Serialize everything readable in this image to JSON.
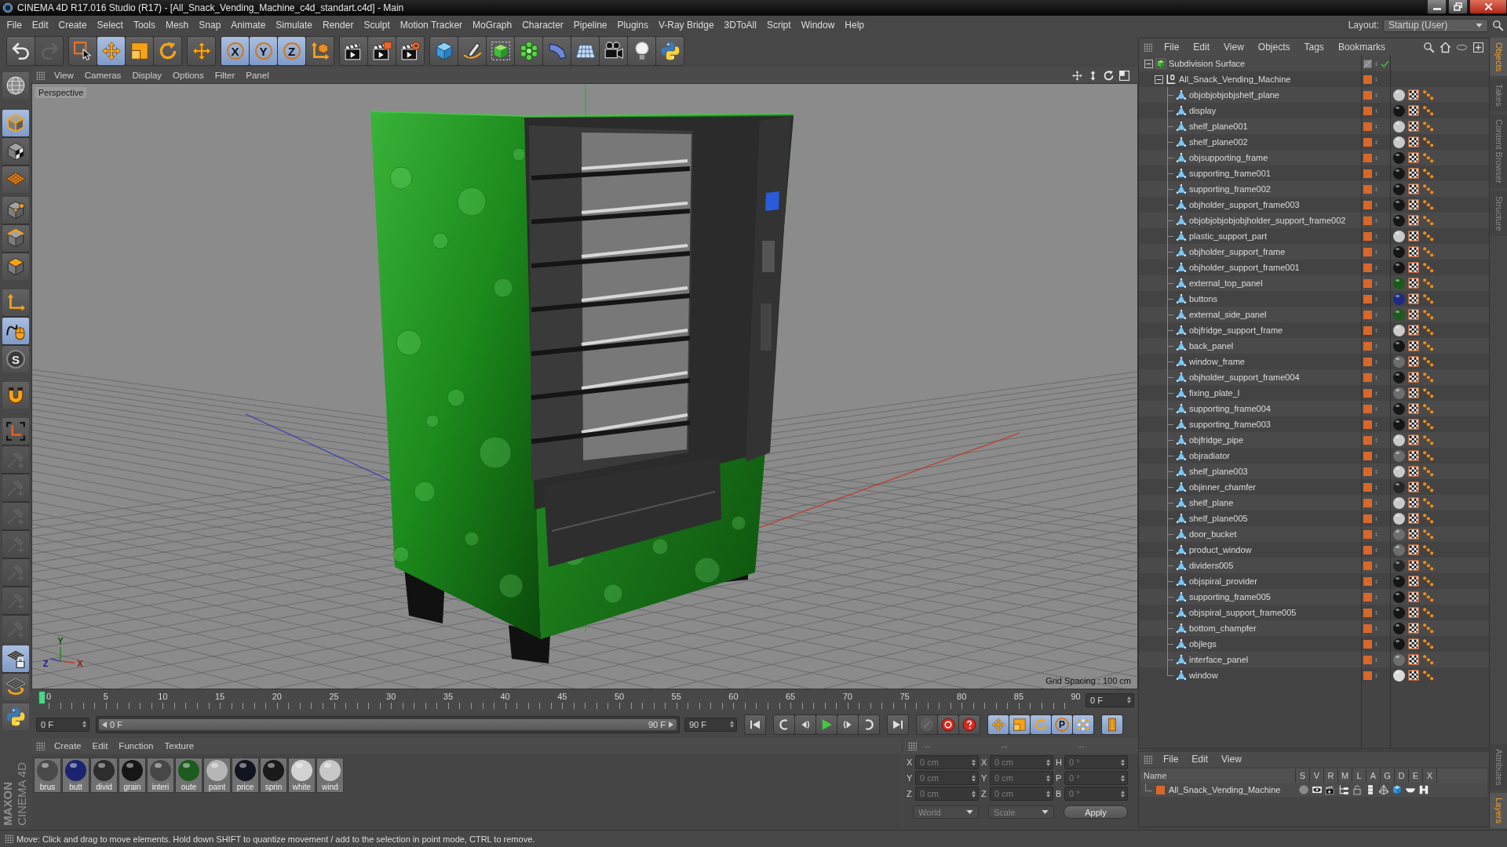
{
  "window": {
    "title": "CINEMA 4D R17.016 Studio (R17) - [All_Snack_Vending_Machine_c4d_standart.c4d] - Main"
  },
  "menu_bar": [
    "File",
    "Edit",
    "Create",
    "Select",
    "Tools",
    "Mesh",
    "Snap",
    "Animate",
    "Simulate",
    "Render",
    "Sculpt",
    "Motion Tracker",
    "MoGraph",
    "Character",
    "Pipeline",
    "Plugins",
    "V-Ray Bridge",
    "3DToAll",
    "Script",
    "Window",
    "Help"
  ],
  "layout": {
    "label": "Layout:",
    "value": "Startup (User)"
  },
  "toolbar": [
    {
      "tools": [
        {
          "kind": "undo",
          "selected": false,
          "disabled": false
        },
        {
          "kind": "redo",
          "selected": false,
          "disabled": true
        }
      ]
    },
    {
      "tools": [
        {
          "kind": "select",
          "selected": false,
          "disabled": false
        },
        {
          "kind": "move",
          "selected": true,
          "disabled": false
        },
        {
          "kind": "scale",
          "selected": false,
          "disabled": false
        },
        {
          "kind": "rotate",
          "selected": false,
          "disabled": false
        }
      ]
    },
    {
      "tools": [
        {
          "kind": "recent",
          "selected": false,
          "disabled": false
        }
      ]
    },
    {
      "tools": [
        {
          "kind": "axis",
          "label": "X",
          "selected": true,
          "disabled": false
        },
        {
          "kind": "axis",
          "label": "Y",
          "selected": true,
          "disabled": false
        },
        {
          "kind": "axis",
          "label": "Z",
          "selected": true,
          "disabled": false
        },
        {
          "kind": "coords",
          "selected": false,
          "disabled": false
        }
      ]
    },
    {
      "tools": [
        {
          "kind": "renderview",
          "selected": false,
          "disabled": false
        },
        {
          "kind": "renderpicture",
          "selected": false,
          "disabled": false
        },
        {
          "kind": "rendersettings",
          "selected": false,
          "disabled": false
        }
      ]
    },
    {
      "tools": [
        {
          "kind": "cube",
          "selected": false,
          "disabled": false
        },
        {
          "kind": "pen",
          "selected": false,
          "disabled": false
        },
        {
          "kind": "subdivision",
          "selected": false,
          "disabled": false
        },
        {
          "kind": "cloner",
          "selected": false,
          "disabled": false
        },
        {
          "kind": "bend",
          "selected": false,
          "disabled": false
        },
        {
          "kind": "floor",
          "selected": false,
          "disabled": false
        },
        {
          "kind": "camera",
          "selected": false,
          "disabled": false
        },
        {
          "kind": "light",
          "selected": false,
          "disabled": false
        },
        {
          "kind": "python",
          "selected": false,
          "disabled": false
        }
      ]
    }
  ],
  "tool_column": [
    {
      "tools": [
        {
          "kind": "navigate",
          "selected": false,
          "disabled": false
        }
      ]
    },
    {
      "tools": [
        {
          "kind": "model",
          "selected": true,
          "disabled": false
        },
        {
          "kind": "texture",
          "selected": false,
          "disabled": false
        },
        {
          "kind": "workplane",
          "selected": false,
          "disabled": false
        }
      ]
    },
    {
      "tools": [
        {
          "kind": "points",
          "selected": false,
          "disabled": false
        },
        {
          "kind": "edges",
          "selected": false,
          "disabled": false
        },
        {
          "kind": "polygons",
          "selected": false,
          "disabled": false
        }
      ]
    },
    {
      "tools": [
        {
          "kind": "axes",
          "selected": false,
          "disabled": false
        },
        {
          "kind": "tweak",
          "selected": true,
          "disabled": false
        },
        {
          "kind": "snap",
          "label": "S",
          "selected": false,
          "disabled": false
        }
      ]
    },
    {
      "tools": [
        {
          "kind": "magnet",
          "selected": false,
          "disabled": false
        }
      ]
    },
    {
      "tools": [
        {
          "kind": "axisframe",
          "selected": false,
          "disabled": false
        },
        {
          "kind": "pin",
          "selected": false,
          "disabled": true
        },
        {
          "kind": "pin",
          "selected": false,
          "disabled": true
        },
        {
          "kind": "pin",
          "selected": false,
          "disabled": true
        },
        {
          "kind": "pin",
          "selected": false,
          "disabled": true
        },
        {
          "kind": "pin",
          "selected": false,
          "disabled": true
        },
        {
          "kind": "pin",
          "selected": false,
          "disabled": true
        },
        {
          "kind": "pin",
          "selected": false,
          "disabled": true
        }
      ]
    },
    {
      "tools": [
        {
          "kind": "gridlock",
          "selected": true,
          "disabled": false
        },
        {
          "kind": "gridrotate",
          "selected": false,
          "disabled": false
        }
      ]
    },
    {
      "tools": [
        {
          "kind": "python",
          "selected": false,
          "disabled": false
        }
      ]
    }
  ],
  "logo": [
    "MAXON",
    "CINEMA 4D"
  ],
  "viewport": {
    "menu": [
      "View",
      "Cameras",
      "Display",
      "Options",
      "Filter",
      "Panel"
    ],
    "camera": "Perspective",
    "grid_spacing": "Grid Spacing : 100 cm",
    "axis_labels": [
      "Y",
      "Z",
      "X"
    ]
  },
  "timeline": {
    "ticks": [
      "0",
      "5",
      "10",
      "15",
      "20",
      "25",
      "30",
      "35",
      "40",
      "45",
      "50",
      "55",
      "60",
      "65",
      "70",
      "75",
      "80",
      "85",
      "90"
    ],
    "frame": "0 F"
  },
  "transport": {
    "start": "0 F",
    "range": {
      "start": "0 F",
      "end": "90 F",
      "level": 1
    },
    "end": "90 F",
    "record": [
      {
        "kind": "keyframe",
        "disabled": true
      },
      {
        "kind": "record",
        "disabled": false
      },
      {
        "kind": "autokey",
        "disabled": false
      }
    ],
    "key_filters": [
      {
        "kind": "move",
        "selected": true
      },
      {
        "kind": "scale",
        "selected": true
      },
      {
        "kind": "rotate",
        "selected": true
      },
      {
        "kind": "param",
        "label": "P",
        "selected": true
      },
      {
        "kind": "pointlevel",
        "selected": true
      }
    ],
    "timeline_button": {
      "kind": "timeline",
      "selected": true
    }
  },
  "materials": {
    "menu": [
      "Create",
      "Edit",
      "Function",
      "Texture"
    ],
    "items": [
      {
        "name": "brus",
        "color": "#4a4a4a"
      },
      {
        "name": "butt",
        "color": "#1c2470"
      },
      {
        "name": "divid",
        "color": "#2d2d2d"
      },
      {
        "name": "grain",
        "color": "#161616"
      },
      {
        "name": "interi",
        "color": "#474747"
      },
      {
        "name": "oute",
        "color": "#1d5a1d"
      },
      {
        "name": "paint",
        "color": "#b5b5b5"
      },
      {
        "name": "price",
        "color": "#121421"
      },
      {
        "name": "sprin",
        "color": "#1a1a1a"
      },
      {
        "name": "white",
        "color": "#d2d2d2"
      },
      {
        "name": "wind",
        "color": "#c8c8c8"
      }
    ]
  },
  "coordinates": {
    "headers": [
      "--",
      "--",
      "--"
    ],
    "rows": [
      {
        "cells": [
          {
            "label": "X",
            "value": "0 cm"
          },
          {
            "label": "X",
            "value": "0 cm"
          },
          {
            "label": "H",
            "value": "0 °"
          }
        ]
      },
      {
        "cells": [
          {
            "label": "Y",
            "value": "0 cm"
          },
          {
            "label": "Y",
            "value": "0 cm"
          },
          {
            "label": "P",
            "value": "0 °"
          }
        ]
      },
      {
        "cells": [
          {
            "label": "Z",
            "value": "0 cm"
          },
          {
            "label": "Z",
            "value": "0 cm"
          },
          {
            "label": "B",
            "value": "0 °"
          }
        ]
      }
    ],
    "mode": "World",
    "scale": "Scale",
    "apply": "Apply"
  },
  "object_manager": {
    "menu": [
      "File",
      "Edit",
      "View",
      "Objects",
      "Tags",
      "Bookmarks"
    ],
    "tree": [
      {
        "name": "Subdivision Surface",
        "kind": "generator",
        "expanded": true,
        "enabled": true,
        "children": [
          {
            "name": "All_Snack_Vending_Machine",
            "kind": "null",
            "expanded": true,
            "children": [
              {
                "name": "objobjobjobjshelf_plane",
                "kind": "polygon",
                "color": "#c9c9c9"
              },
              {
                "name": "display",
                "kind": "polygon",
                "color": "#151515"
              },
              {
                "name": "shelf_plane001",
                "kind": "polygon",
                "color": "#c9c9c9"
              },
              {
                "name": "shelf_plane002",
                "kind": "polygon",
                "color": "#c9c9c9"
              },
              {
                "name": "objsupporting_frame",
                "kind": "polygon",
                "color": "#151515"
              },
              {
                "name": "supporting_frame001",
                "kind": "polygon",
                "color": "#151515"
              },
              {
                "name": "supporting_frame002",
                "kind": "polygon",
                "color": "#151515"
              },
              {
                "name": "objholder_support_frame003",
                "kind": "polygon",
                "color": "#151515"
              },
              {
                "name": "objobjobjobjobjholder_support_frame002",
                "kind": "polygon",
                "color": "#151515"
              },
              {
                "name": "plastic_support_part",
                "kind": "polygon",
                "color": "#c9c9c9"
              },
              {
                "name": "objholder_support_frame",
                "kind": "polygon",
                "color": "#151515"
              },
              {
                "name": "objholder_support_frame001",
                "kind": "polygon",
                "color": "#151515"
              },
              {
                "name": "external_top_panel",
                "kind": "polygon",
                "color": "#1d5a1d"
              },
              {
                "name": "buttons",
                "kind": "polygon",
                "color": "#1e2a86"
              },
              {
                "name": "external_side_panel",
                "kind": "polygon",
                "color": "#1d5a1d"
              },
              {
                "name": "objfridge_support_frame",
                "kind": "polygon",
                "color": "#c9c9c9"
              },
              {
                "name": "back_panel",
                "kind": "polygon",
                "color": "#151515"
              },
              {
                "name": "window_frame",
                "kind": "polygon",
                "color": "#6e6e6e"
              },
              {
                "name": "objholder_support_frame004",
                "kind": "polygon",
                "color": "#151515"
              },
              {
                "name": "fixing_plate_l",
                "kind": "polygon",
                "color": "#6e6e6e"
              },
              {
                "name": "supporting_frame004",
                "kind": "polygon",
                "color": "#151515"
              },
              {
                "name": "supporting_frame003",
                "kind": "polygon",
                "color": "#151515"
              },
              {
                "name": "objfridge_pipe",
                "kind": "polygon",
                "color": "#c9c9c9"
              },
              {
                "name": "objradiator",
                "kind": "polygon",
                "color": "#6e6e6e"
              },
              {
                "name": "shelf_plane003",
                "kind": "polygon",
                "color": "#c9c9c9"
              },
              {
                "name": "objinner_chamfer",
                "kind": "polygon",
                "color": "#262626"
              },
              {
                "name": "shelf_plane",
                "kind": "polygon",
                "color": "#c9c9c9"
              },
              {
                "name": "shelf_plane005",
                "kind": "polygon",
                "color": "#c9c9c9"
              },
              {
                "name": "door_bucket",
                "kind": "polygon",
                "color": "#6e6e6e"
              },
              {
                "name": "product_window",
                "kind": "polygon",
                "color": "#6e6e6e"
              },
              {
                "name": "dividers005",
                "kind": "polygon",
                "color": "#262626"
              },
              {
                "name": "objspiral_provider",
                "kind": "polygon",
                "color": "#151515"
              },
              {
                "name": "supporting_frame005",
                "kind": "polygon",
                "color": "#151515"
              },
              {
                "name": "objspiral_support_frame005",
                "kind": "polygon",
                "color": "#151515"
              },
              {
                "name": "bottom_champfer",
                "kind": "polygon",
                "color": "#151515"
              },
              {
                "name": "objlegs",
                "kind": "polygon",
                "color": "#151515"
              },
              {
                "name": "interface_panel",
                "kind": "polygon",
                "color": "#6e6e6e"
              },
              {
                "name": "window",
                "kind": "polygon",
                "color": "#dcdcdc"
              }
            ]
          }
        ]
      }
    ]
  },
  "side_tabs": [
    {
      "label": "Objects",
      "selected": true
    },
    {
      "label": "Takes",
      "selected": false
    },
    {
      "label": "Content Browser",
      "selected": false
    },
    {
      "label": "Structure",
      "selected": false
    }
  ],
  "side_tabs_lower": [
    {
      "label": "Attributes",
      "selected": false
    },
    {
      "label": "Layers",
      "selected": true
    }
  ],
  "layer_manager": {
    "menu": [
      "File",
      "Edit",
      "View"
    ],
    "columns": [
      "Name",
      "S",
      "V",
      "R",
      "M",
      "L",
      "A",
      "G",
      "D",
      "E",
      "X"
    ],
    "rows": [
      {
        "name": "All_Snack_Vending_Machine"
      }
    ]
  },
  "status_bar": "Move: Click and drag to move elements. Hold down SHIFT to quantize movement / add to the selection in point mode, CTRL to remove."
}
